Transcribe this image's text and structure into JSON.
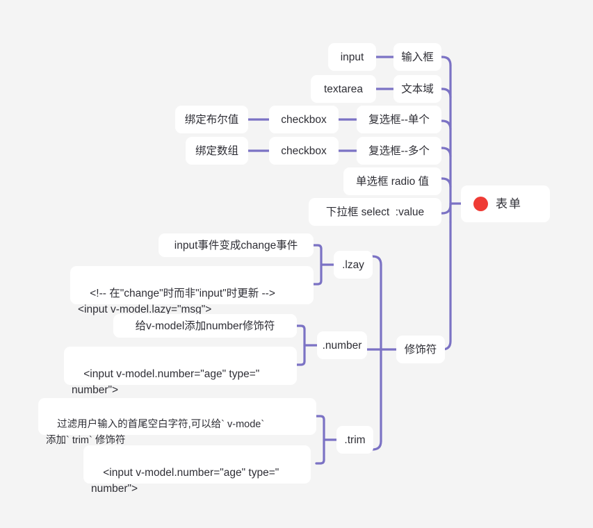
{
  "canvas": {
    "background": "#f4f4f4",
    "node_background": "#ffffff",
    "connector_color": "#7b72c4",
    "text_color": "#2e2e35",
    "accent_dot_color": "#ef3b35"
  },
  "root": {
    "label": "表单",
    "dot": "red-circle-icon"
  },
  "nodes": {
    "input_label": "input",
    "input_cn": "输入框",
    "textarea_label": "textarea",
    "textarea_cn": "文本域",
    "checkbox_single": "checkbox",
    "checkbox_single_cn": "复选框--单个",
    "bind_boolean": "绑定布尔值",
    "checkbox_multi": "checkbox",
    "checkbox_multi_cn": "复选框--多个",
    "bind_array": "绑定数组",
    "radio_cn": "单选框 radio 值",
    "select_cn": "下拉框 select  :value",
    "modifiers_cn": "修饰符",
    "lazy_label": ".lzay",
    "lazy_desc": "input事件变成change事件",
    "lazy_code": "<!-- 在\"change\"时而非\"input\"时更新 -->\n<input v-model.lazy=\"msg\">",
    "number_label": ".number",
    "number_desc": "给v-model添加number修饰符",
    "number_code": "<input v-model.number=\"age\" type=\"\nnumber\">",
    "trim_label": ".trim",
    "trim_desc": "过滤用户输入的首尾空白字符,可以给` v-mode`\n添加` trim` 修饰符",
    "trim_code": "<input v-model.number=\"age\" type=\"\nnumber\">"
  },
  "chart_data": {
    "type": "diagram",
    "diagram_type": "mindmap",
    "title": "表单",
    "orientation": "right-to-left-branches",
    "tree": {
      "label": "表单",
      "children": [
        {
          "label": "输入框",
          "children": [
            {
              "label": "input",
              "children": []
            }
          ]
        },
        {
          "label": "文本域",
          "children": [
            {
              "label": "textarea",
              "children": []
            }
          ]
        },
        {
          "label": "复选框--单个",
          "children": [
            {
              "label": "checkbox",
              "children": [
                {
                  "label": "绑定布尔值",
                  "children": []
                }
              ]
            }
          ]
        },
        {
          "label": "复选框--多个",
          "children": [
            {
              "label": "checkbox",
              "children": [
                {
                  "label": "绑定数组",
                  "children": []
                }
              ]
            }
          ]
        },
        {
          "label": "单选框 radio 值",
          "children": []
        },
        {
          "label": "下拉框 select  :value",
          "children": []
        },
        {
          "label": "修饰符",
          "children": [
            {
              "label": ".lzay",
              "children": [
                {
                  "label": "input事件变成change事件",
                  "children": []
                },
                {
                  "label": "<!-- 在\"change\"时而非\"input\"时更新 --> <input v-model.lazy=\"msg\">",
                  "children": []
                }
              ]
            },
            {
              "label": ".number",
              "children": [
                {
                  "label": "给v-model添加number修饰符",
                  "children": []
                },
                {
                  "label": "<input v-model.number=\"age\" type=\"number\">",
                  "children": []
                }
              ]
            },
            {
              "label": ".trim",
              "children": [
                {
                  "label": "过滤用户输入的首尾空白字符,可以给` v-mode` 添加` trim` 修饰符",
                  "children": []
                },
                {
                  "label": "<input v-model.number=\"age\" type=\"number\">",
                  "children": []
                }
              ]
            }
          ]
        }
      ]
    }
  }
}
